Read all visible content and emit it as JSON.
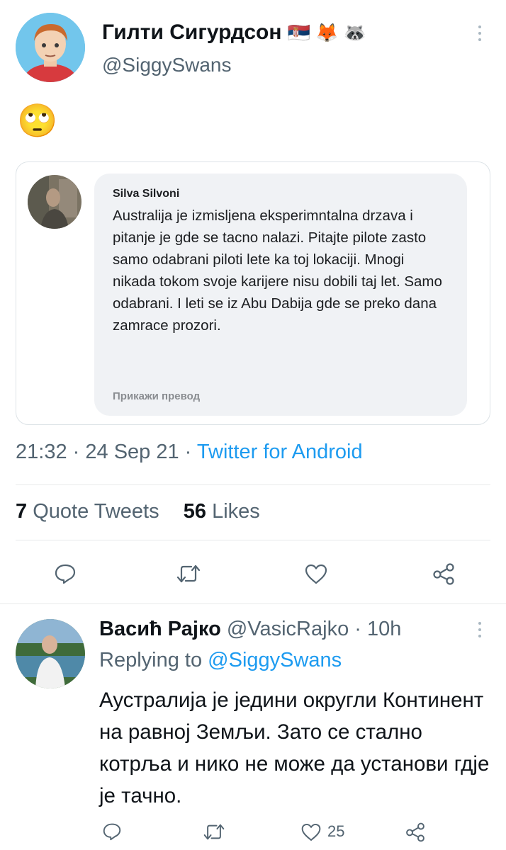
{
  "tweet": {
    "author_name": "Гилти Сигурдсон",
    "author_emojis": "🇷🇸 🦊 🦝",
    "author_handle": "@SiggySwans",
    "body_emoji": "🙄",
    "quoted_card": {
      "commenter_name": "Silva Silvoni",
      "comment_text": "Australija je izmisljena eksperimntalna drzava i pitanje je gde se tacno nalazi. Pitajte pilote zasto samo odabrani piloti lete ka toj lokaciji. Mnogi nikada tokom svoje karijere nisu dobili taj let. Samo odabrani. I leti se iz Abu Dabija gde se preko dana zamrace prozori.",
      "translate_link": "Прикажи превод"
    },
    "time": "21:32",
    "date": "24 Sep 21",
    "source": "Twitter for Android",
    "quote_tweets_count": "7",
    "quote_tweets_label": "Quote Tweets",
    "likes_count": "56",
    "likes_label": "Likes"
  },
  "reply": {
    "author_name": "Васић Рајко",
    "author_handle": "@VasicRajko",
    "time_ago": "10h",
    "replying_prefix": "Replying to",
    "replying_to": "@SiggySwans",
    "text": "Аустралија је једини округли Континент на равној Земљи. Зато се стално котрља и нико не може да установи гдје је тачно.",
    "like_count": "25"
  },
  "separator": "·",
  "icons": [
    "reply-icon",
    "retweet-icon",
    "like-icon",
    "share-icon",
    "more-options-icon"
  ],
  "colors": {
    "accent": "#1d9bf0",
    "text": "#0f1419",
    "muted": "#536471",
    "divider": "#e7e9ea"
  }
}
